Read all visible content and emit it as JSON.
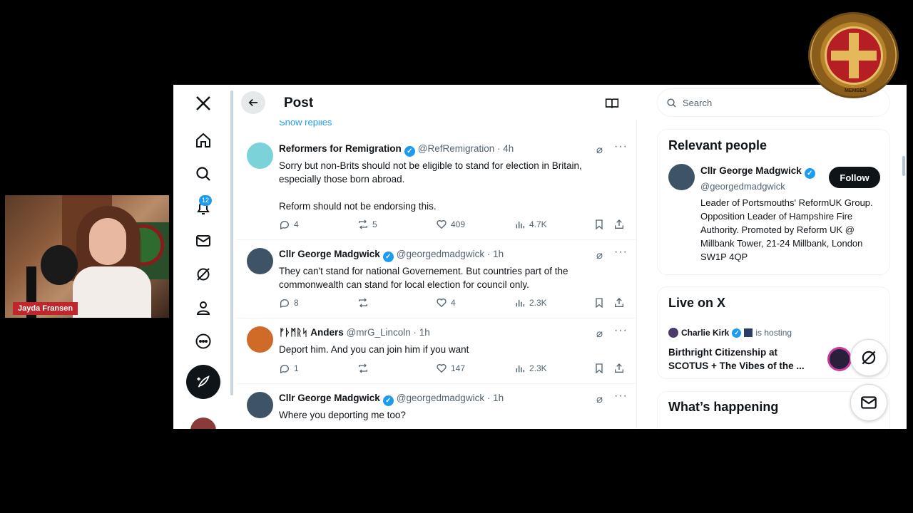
{
  "webcam": {
    "name_tag": "Jayda Fransen"
  },
  "badge": {
    "ring_text": "MEMBER"
  },
  "nav": {
    "notifications_count": "12"
  },
  "header": {
    "title": "Post"
  },
  "show_replies": "Show replies",
  "tweets": [
    {
      "name": "Reformers for Remigration",
      "handle": "@RefRemigration · 4h",
      "text": "Sorry but non-Brits should not be eligible to stand for election in Britain, especially those born abroad.\n\nReform should not be endorsing this.",
      "replies": "4",
      "reposts": "5",
      "likes": "409",
      "views": "4.7K"
    },
    {
      "name": "Cllr George Madgwick",
      "handle": "@georgedmadgwick · 1h",
      "text": "They can't stand for national Governement. But countries part of the commonwealth can stand for local election for council only.",
      "replies": "8",
      "reposts": "",
      "likes": "4",
      "views": "2.3K"
    },
    {
      "name": "ᚠᚦᛗᚱᛋ Anders",
      "handle": "@mrG_Lincoln · 1h",
      "text": "Deport him. And you can join him if you want",
      "replies": "1",
      "reposts": "",
      "likes": "147",
      "views": "2.3K"
    },
    {
      "name": "Cllr George Madgwick",
      "handle": "@georgedmadgwick · 1h",
      "text": "Where you deporting me too?"
    }
  ],
  "search": {
    "placeholder": "Search"
  },
  "relevant": {
    "title": "Relevant people",
    "name": "Cllr George Madgwick",
    "handle": "@georgedmadgwick",
    "follow": "Follow",
    "bio": "Leader of Portsmouths' ReformUK Group. Opposition Leader of Hampshire Fire Authority. Promoted by Reform UK @ Millbank Tower, 21-24 Millbank, London SW1P 4QP"
  },
  "live": {
    "title": "Live on X",
    "host": "Charlie Kirk",
    "hosting": "is hosting",
    "space_title": "Birthright Citizenship at SCOTUS + The Vibes of the ..."
  },
  "whats_happening": {
    "title": "What’s happening"
  },
  "colors": {
    "accent": "#1d9bf0",
    "text": "#0f1419",
    "muted": "#536471",
    "name_tag": "#c0272d"
  }
}
